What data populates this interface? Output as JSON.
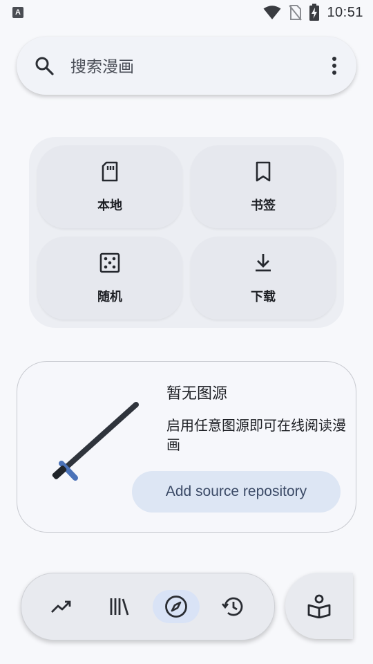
{
  "status_bar": {
    "time": "10:51",
    "app_badge": "A"
  },
  "search": {
    "placeholder": "搜索漫画",
    "search_icon": "search-icon",
    "more_icon": "more-vert-icon"
  },
  "quick_actions": [
    {
      "label": "本地",
      "icon": "sd-card-icon"
    },
    {
      "label": "书签",
      "icon": "bookmark-icon"
    },
    {
      "label": "随机",
      "icon": "dice-icon"
    },
    {
      "label": "下载",
      "icon": "download-icon"
    }
  ],
  "empty_state": {
    "title": "暂无图源",
    "description": "启用任意图源即可在线阅读漫画",
    "button_label": "Add source repository"
  },
  "bottom_nav": [
    {
      "icon": "trending-icon",
      "active": false
    },
    {
      "icon": "library-icon",
      "active": false
    },
    {
      "icon": "explore-compass-icon",
      "active": true
    },
    {
      "icon": "history-icon",
      "active": false
    }
  ],
  "fab_icon": "reader-icon",
  "colors": {
    "accent_bg": "#d9e3f6",
    "button_bg": "#dde6f4",
    "button_text": "#3b4a66"
  }
}
